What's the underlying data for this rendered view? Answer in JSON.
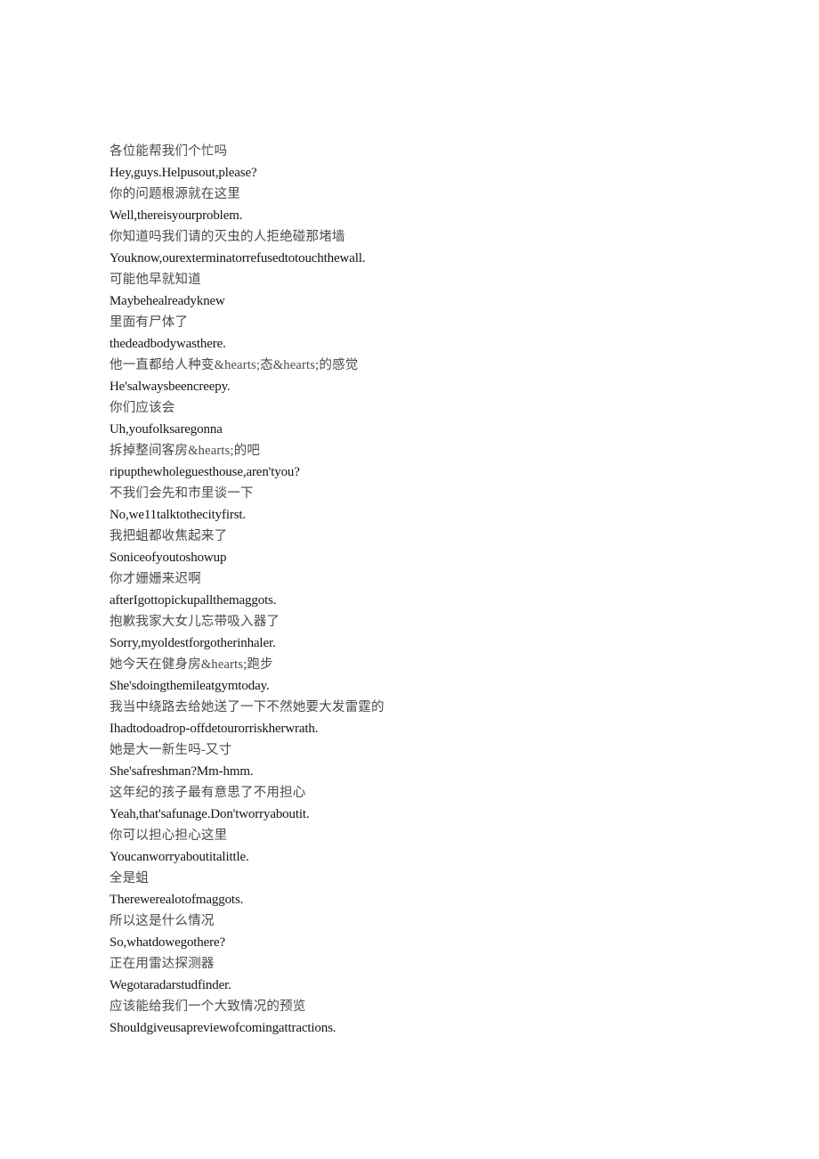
{
  "document": {
    "background_color": "#ffffff",
    "text_color_zh": "#4a4a4a",
    "text_color_en": "#141414",
    "lines": [
      {
        "lang": "zh",
        "text": "各位能帮我们个忙吗"
      },
      {
        "lang": "en",
        "text": "Hey,guys.Helpusout,please?"
      },
      {
        "lang": "zh",
        "text": "你的问题根源就在这里"
      },
      {
        "lang": "en",
        "text": "Well,thereisyourproblem."
      },
      {
        "lang": "zh",
        "text": "你知道吗我们请的灭虫的人拒绝碰那堵墙"
      },
      {
        "lang": "en",
        "text": "Youknow,ourexterminatorrefusedtotouchthewall."
      },
      {
        "lang": "zh",
        "text": "可能他早就知道"
      },
      {
        "lang": "en",
        "text": "Maybehealreadyknew"
      },
      {
        "lang": "zh",
        "text": "里面有尸体了"
      },
      {
        "lang": "en",
        "text": "thedeadbodywasthere."
      },
      {
        "lang": "zh",
        "text": "他一直都给人种变&hearts;态&hearts;的感觉"
      },
      {
        "lang": "en",
        "text": "He'salwaysbeencreepy."
      },
      {
        "lang": "zh",
        "text": "你们应该会"
      },
      {
        "lang": "en",
        "text": "Uh,youfolksaregonna"
      },
      {
        "lang": "zh",
        "text": "拆掉整间客房&hearts;的吧"
      },
      {
        "lang": "en",
        "text": "ripupthewholeguesthouse,aren'tyou?"
      },
      {
        "lang": "zh",
        "text": "不我们会先和市里谈一下"
      },
      {
        "lang": "en",
        "text": "No,we11talktothecityfirst."
      },
      {
        "lang": "zh",
        "text": "我把蛆都收焦起来了"
      },
      {
        "lang": "en",
        "text": "Soniceofyoutoshowup"
      },
      {
        "lang": "zh",
        "text": "你才姗姗来迟啊"
      },
      {
        "lang": "en",
        "text": "afterIgottopickupallthemaggots."
      },
      {
        "lang": "zh",
        "text": "抱歉我家大女儿忘带吸入器了"
      },
      {
        "lang": "en",
        "text": "Sorry,myoldestforgotherinhaler."
      },
      {
        "lang": "zh",
        "text": "她今天在健身房&hearts;跑步"
      },
      {
        "lang": "en",
        "text": "She'sdoingthemileatgymtoday."
      },
      {
        "lang": "zh",
        "text": "我当中绕路去给她送了一下不然她要大发雷霆的"
      },
      {
        "lang": "en",
        "text": "Ihadtodoadrop-offdetourorriskherwrath."
      },
      {
        "lang": "zh",
        "text": "她是大一新生吗-又寸"
      },
      {
        "lang": "en",
        "text": "She'safreshman?Mm-hmm."
      },
      {
        "lang": "zh",
        "text": "这年纪的孩子最有意思了不用担心"
      },
      {
        "lang": "en",
        "text": "Yeah,that'safunage.Don'tworryaboutit."
      },
      {
        "lang": "zh",
        "text": "你可以担心担心这里"
      },
      {
        "lang": "en",
        "text": "Youcanworryaboutitalittle."
      },
      {
        "lang": "zh",
        "text": "全是蛆"
      },
      {
        "lang": "en",
        "text": "Therewerealotofmaggots."
      },
      {
        "lang": "zh",
        "text": "所以这是什么情况"
      },
      {
        "lang": "en",
        "text": "So,whatdowegothere?"
      },
      {
        "lang": "zh",
        "text": "正在用雷达探测器"
      },
      {
        "lang": "en",
        "text": "Wegotaradarstudfinder."
      },
      {
        "lang": "zh",
        "text": "应该能给我们一个大致情况的预览"
      },
      {
        "lang": "en",
        "text": "Shouldgiveusapreviewofcomingattractions."
      }
    ]
  }
}
